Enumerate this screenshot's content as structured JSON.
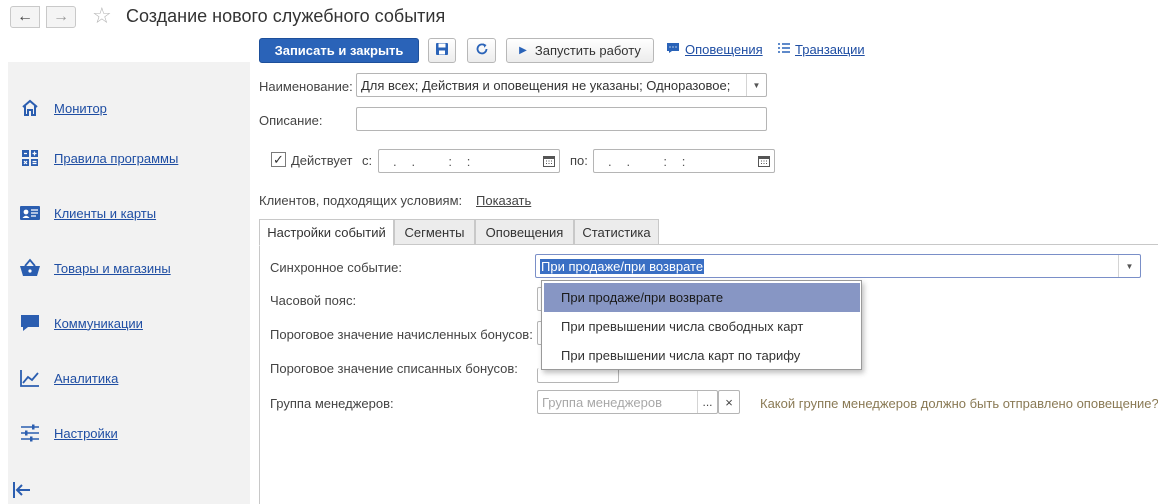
{
  "window": {
    "title": "Создание нового служебного события"
  },
  "toolbar": {
    "save_close_label": "Записать и закрыть",
    "run_label": "Запустить работу",
    "notifications_link": "Оповещения",
    "transactions_link": "Транзакции"
  },
  "sidebar": {
    "items": [
      {
        "label": "Монитор",
        "icon": "home-icon"
      },
      {
        "label": "Правила программы",
        "icon": "rules-grid-icon"
      },
      {
        "label": "Клиенты и карты",
        "icon": "client-card-icon"
      },
      {
        "label": "Товары и магазины",
        "icon": "basket-icon"
      },
      {
        "label": "Коммуникации",
        "icon": "chat-icon"
      },
      {
        "label": "Аналитика",
        "icon": "chart-icon"
      },
      {
        "label": "Настройки",
        "icon": "sliders-icon"
      }
    ]
  },
  "form": {
    "name_label": "Наименование:",
    "name_value": "Для всех; Действия и оповещения не указаны; Одноразовое;",
    "description_label": "Описание:",
    "description_value": "",
    "active_label": "Действует",
    "active_checked": true,
    "from_label": "с:",
    "from_value": ".   .       :   :",
    "to_label": "по:",
    "to_value": ".   .       :   :",
    "clients_label": "Клиентов, подходящих условиям:",
    "show_link": "Показать"
  },
  "tabs": [
    {
      "label": "Настройки событий",
      "active": true
    },
    {
      "label": "Сегменты",
      "active": false
    },
    {
      "label": "Оповещения",
      "active": false
    },
    {
      "label": "Статистика",
      "active": false
    }
  ],
  "settings": {
    "sync_event_label": "Синхронное событие:",
    "sync_event_value": "При продаже/при возврате",
    "timezone_label": "Часовой пояс:",
    "accrued_threshold_label": "Пороговое значение начисленных бонусов:",
    "written_off_threshold_label": "Пороговое значение списанных бонусов:",
    "manager_group_label": "Группа менеджеров:",
    "manager_group_placeholder": "Группа менеджеров",
    "manager_group_hint": "Какой группе менеджеров должно быть отправлено оповещение?"
  },
  "dropdown": {
    "options": [
      {
        "label": "При продаже/при возврате",
        "selected": true
      },
      {
        "label": "При превышении числа свободных карт",
        "selected": false
      },
      {
        "label": "При превышении числа карт по тарифу",
        "selected": false
      }
    ]
  },
  "colors": {
    "primary": "#2a63b8",
    "link": "#1f4ea3",
    "selection": "#8796c4",
    "hint": "#8a7a55"
  }
}
